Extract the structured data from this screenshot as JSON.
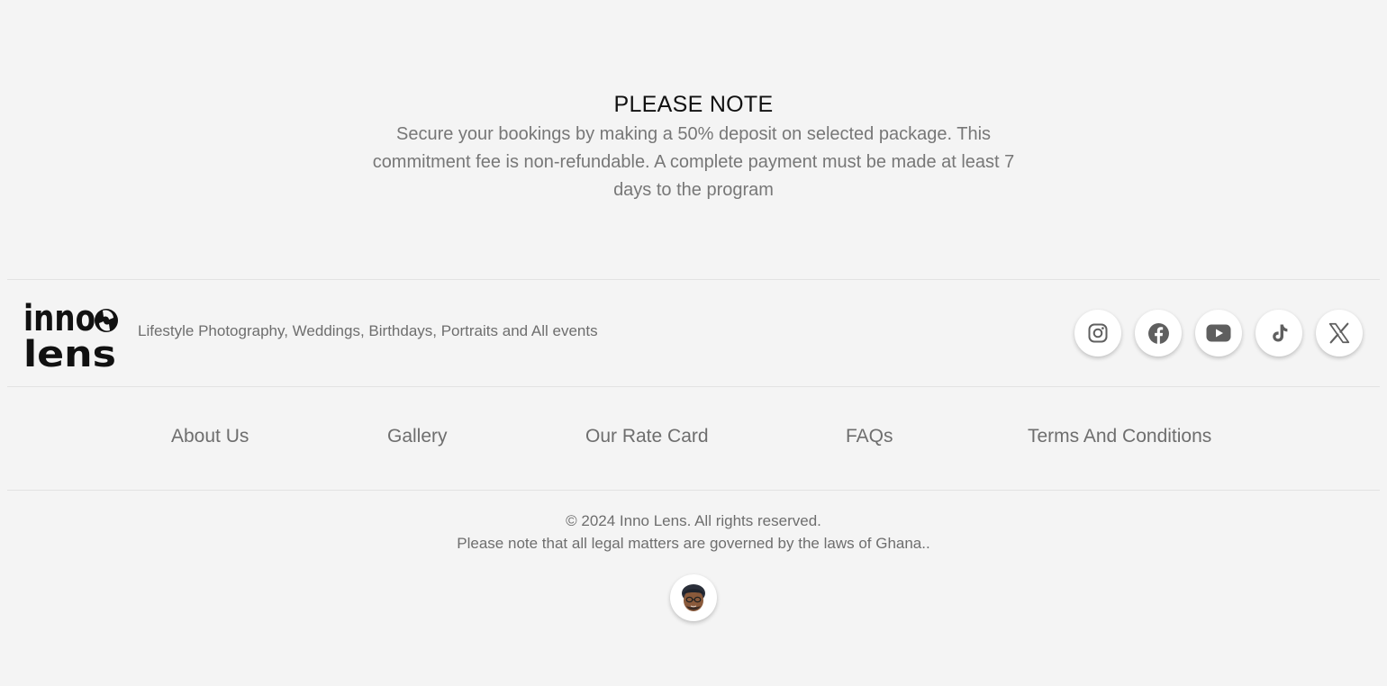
{
  "notice": {
    "title": "PLEASE NOTE",
    "body": "Secure your bookings by making a 50% deposit on selected package. This commitment fee is non-refundable. A complete payment must be made at least 7 days to the program"
  },
  "brand": {
    "logo_line1": "inno",
    "logo_line2": "lens",
    "tagline": "Lifestyle Photography, Weddings, Birthdays, Portraits and All events"
  },
  "socials": [
    {
      "icon": "instagram-icon"
    },
    {
      "icon": "facebook-icon"
    },
    {
      "icon": "youtube-icon"
    },
    {
      "icon": "tiktok-icon"
    },
    {
      "icon": "x-icon"
    }
  ],
  "nav": {
    "about": "About Us",
    "gallery": "Gallery",
    "rate_card": "Our Rate Card",
    "faqs": "FAQs",
    "terms": "Terms And Conditions"
  },
  "footer": {
    "copyright": "© 2024 Inno Lens. All rights reserved.",
    "legal": "Please note that all legal matters are governed by the laws of Ghana.."
  },
  "colors": {
    "background": "#f4f4f4",
    "text": "#6e6e6e",
    "heading": "#111111",
    "icon": "#5f5f5f"
  }
}
